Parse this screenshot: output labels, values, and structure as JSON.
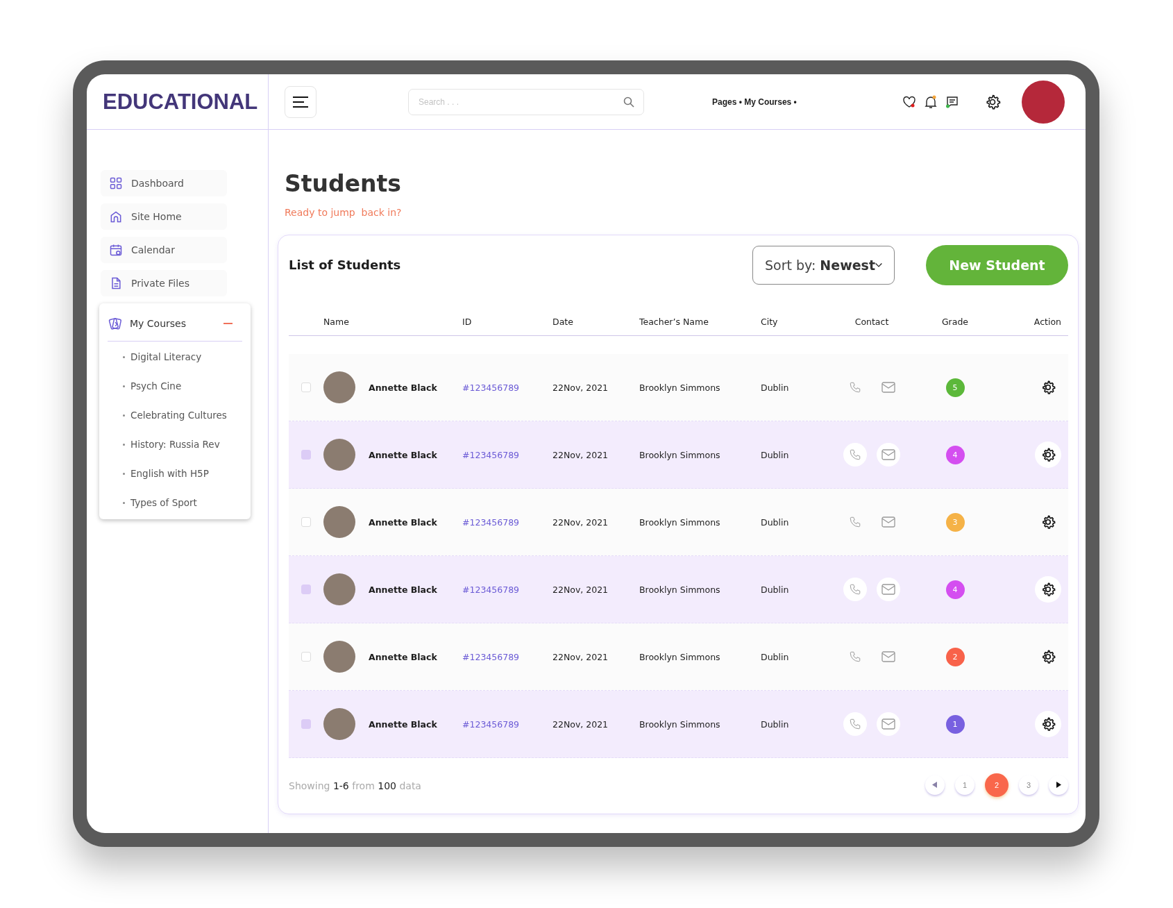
{
  "brand": "EDUCATIONAL",
  "search": {
    "placeholder": "Search . . ."
  },
  "breadcrumb": "Pages • My Courses •",
  "sidebar": {
    "items": [
      {
        "label": "Dashboard"
      },
      {
        "label": "Site Home"
      },
      {
        "label": "Calendar"
      },
      {
        "label": "Private Files"
      },
      {
        "label": "My Courses",
        "expanded": true,
        "children": [
          {
            "label": "Digital Literacy"
          },
          {
            "label": "Psych Cine"
          },
          {
            "label": "Celebrating Cultures"
          },
          {
            "label": "History: Russia Rev"
          },
          {
            "label": "English with H5P"
          },
          {
            "label": "Types of Sport"
          }
        ]
      }
    ]
  },
  "page": {
    "title": "Students",
    "subtitle": "Ready to jump  back in?"
  },
  "card": {
    "title": "List of Students",
    "sort": "Sort by: **Newest**",
    "new_button": "New Student"
  },
  "table": {
    "columns": [
      "Name",
      "ID",
      "Date",
      "Teacher’s Name",
      "City",
      "Contact",
      "Grade",
      "Action"
    ],
    "rows": [
      {
        "name": "Annette Black",
        "id": "#123456789",
        "date": "22Nov, 2021",
        "teacher": "Brooklyn Simmons",
        "city": "Dublin",
        "grade": "5",
        "color": "#5cb83a",
        "selected": false
      },
      {
        "name": "Annette Black",
        "id": "#123456789",
        "date": "22Nov, 2021",
        "teacher": "Brooklyn Simmons",
        "city": "Dublin",
        "grade": "4",
        "color": "#d44ef0",
        "selected": true
      },
      {
        "name": "Annette Black",
        "id": "#123456789",
        "date": "22Nov, 2021",
        "teacher": "Brooklyn Simmons",
        "city": "Dublin",
        "grade": "3",
        "color": "#f5b247",
        "selected": false
      },
      {
        "name": "Annette Black",
        "id": "#123456789",
        "date": "22Nov, 2021",
        "teacher": "Brooklyn Simmons",
        "city": "Dublin",
        "grade": "4",
        "color": "#d44ef0",
        "selected": true
      },
      {
        "name": "Annette Black",
        "id": "#123456789",
        "date": "22Nov, 2021",
        "teacher": "Brooklyn Simmons",
        "city": "Dublin",
        "grade": "2",
        "color": "#f8624a",
        "selected": false
      },
      {
        "name": "Annette Black",
        "id": "#123456789",
        "date": "22Nov, 2021",
        "teacher": "Brooklyn Simmons",
        "city": "Dublin",
        "grade": "1",
        "color": "#7860e0",
        "selected": true
      }
    ]
  },
  "footer": {
    "summary": "Showing **1-6** from **100** data",
    "pages": [
      {
        "label": "1",
        "selected": false
      },
      {
        "label": "2",
        "selected": true
      },
      {
        "label": "3",
        "selected": false
      }
    ]
  }
}
